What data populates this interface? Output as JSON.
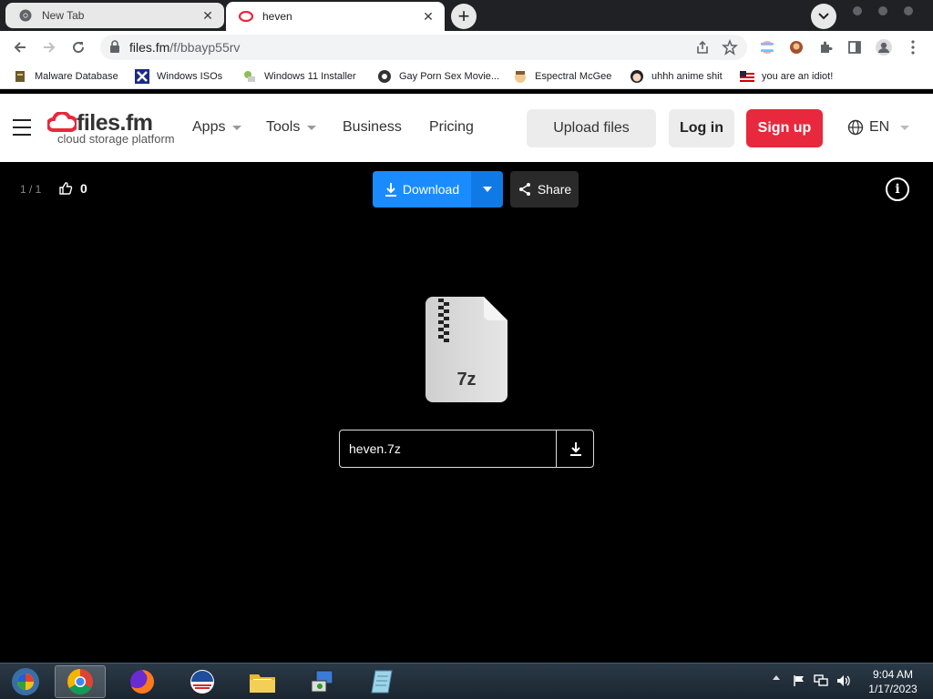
{
  "browser": {
    "tabs": [
      {
        "title": "New Tab",
        "active": false
      },
      {
        "title": "heven",
        "active": true
      }
    ],
    "url_host": "files.fm",
    "url_path": "/f/bbayp55rv",
    "bookmarks": [
      "Malware Database",
      "Windows ISOs",
      "Windows 11 Installer",
      "Gay Porn Sex Movie...",
      "Espectral McGee",
      "uhhh anime shit",
      "you are an idiot!"
    ]
  },
  "site": {
    "brand": "files.fm",
    "tagline": "cloud storage platform",
    "nav": [
      "Apps",
      "Tools",
      "Business",
      "Pricing"
    ],
    "upload_label": "Upload files",
    "login_label": "Log in",
    "signup_label": "Sign up",
    "language": "EN",
    "colors": {
      "signup": "#e8283c",
      "download": "#1a8cff",
      "logo": "#e8283c"
    }
  },
  "viewer": {
    "counter": "1 / 1",
    "likes": "0",
    "download_label": "Download",
    "share_label": "Share",
    "file_ext": "7z",
    "file_name": "heven.7z"
  },
  "taskbar": {
    "time": "9:04 AM",
    "date": "1/17/2023"
  }
}
